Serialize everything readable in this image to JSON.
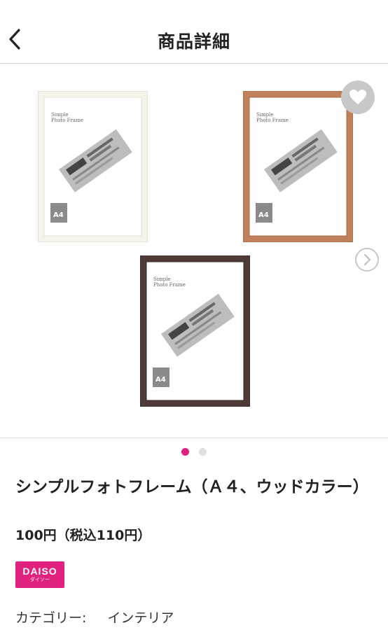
{
  "header": {
    "title": "商品詳細"
  },
  "gallery": {
    "frames": [
      {
        "color": "#f6f3ea",
        "heading": "Simple\nPhoto Frame",
        "size": "A4"
      },
      {
        "color": "#c0815a",
        "heading": "Simple\nPhoto Frame",
        "size": "A4"
      },
      {
        "color": "#4e3a36",
        "heading": "Simple\nPhoto Frame",
        "size": "A4"
      }
    ],
    "page_count": 2,
    "active_page": 1
  },
  "product": {
    "name": "シンプルフォトフレーム（Ａ４、ウッドカラー）",
    "price": "100円（税込110円）",
    "brand": {
      "logo_text": "DAISO",
      "logo_sub": "ダイソー",
      "color": "#e0227e"
    },
    "category_label": "カテゴリー:",
    "category_value": "インテリア"
  }
}
